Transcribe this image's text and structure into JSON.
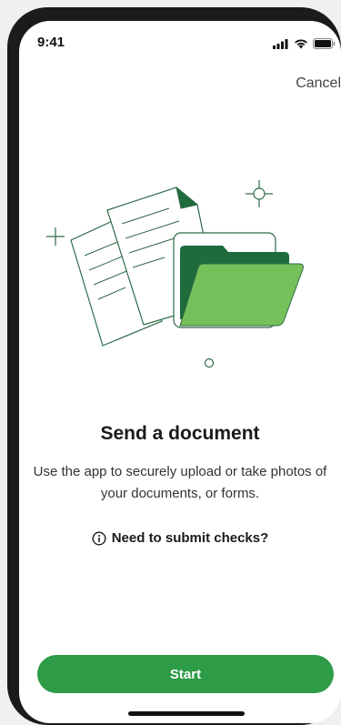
{
  "status_bar": {
    "time": "9:41",
    "icons": [
      "signal-icon",
      "wifi-icon",
      "battery-icon"
    ]
  },
  "header": {
    "cancel_label": "Cancel"
  },
  "illustration": {
    "icon": "documents-folder-illustration",
    "colors": {
      "line": "#2f6b48",
      "folder_dark": "#1e6b3c",
      "folder_light": "#76c05b"
    }
  },
  "content": {
    "title": "Send a document",
    "description": "Use the app to securely upload or take photos of your documents, or forms.",
    "checks_link": {
      "icon": "info-icon",
      "label": "Need to submit checks?"
    }
  },
  "footer": {
    "start_label": "Start",
    "start_color": "#2e9b47"
  }
}
